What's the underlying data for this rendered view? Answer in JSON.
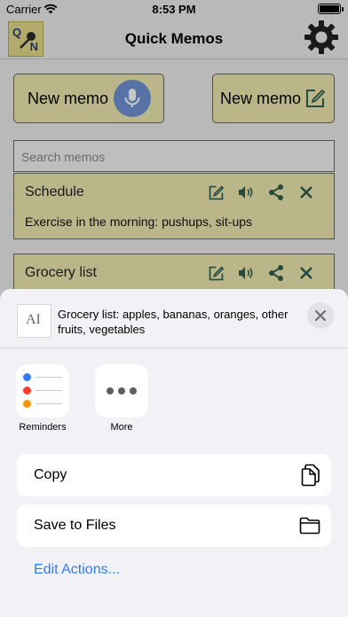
{
  "status_bar": {
    "carrier": "Carrier",
    "time": "8:53 PM"
  },
  "nav": {
    "title": "Quick Memos",
    "logo_letters": [
      "Q",
      "N"
    ]
  },
  "buttons": {
    "voice_memo": "New memo",
    "text_memo": "New memo"
  },
  "search": {
    "placeholder": "Search memos"
  },
  "memos": [
    {
      "title": "Schedule",
      "text": "Exercise in the morning: pushups, sit-ups"
    },
    {
      "title": "Grocery list",
      "text": ""
    }
  ],
  "share_sheet": {
    "preview_text": "Grocery list: apples, bananas, oranges, other fruits, vegetables",
    "thumb_glyph": "AI",
    "apps": [
      {
        "label": "Reminders",
        "icon": "reminders-icon"
      },
      {
        "label": "More",
        "icon": "more-icon"
      }
    ],
    "actions": [
      {
        "label": "Copy",
        "icon": "copy-icon"
      },
      {
        "label": "Save to Files",
        "icon": "folder-icon"
      }
    ],
    "edit_actions": "Edit Actions..."
  },
  "colors": {
    "memo_bg": "#efe9b0",
    "accent_blue": "#2f7cf6",
    "mic_blue": "#6f93d6",
    "icon_green": "#2f5f4f"
  }
}
